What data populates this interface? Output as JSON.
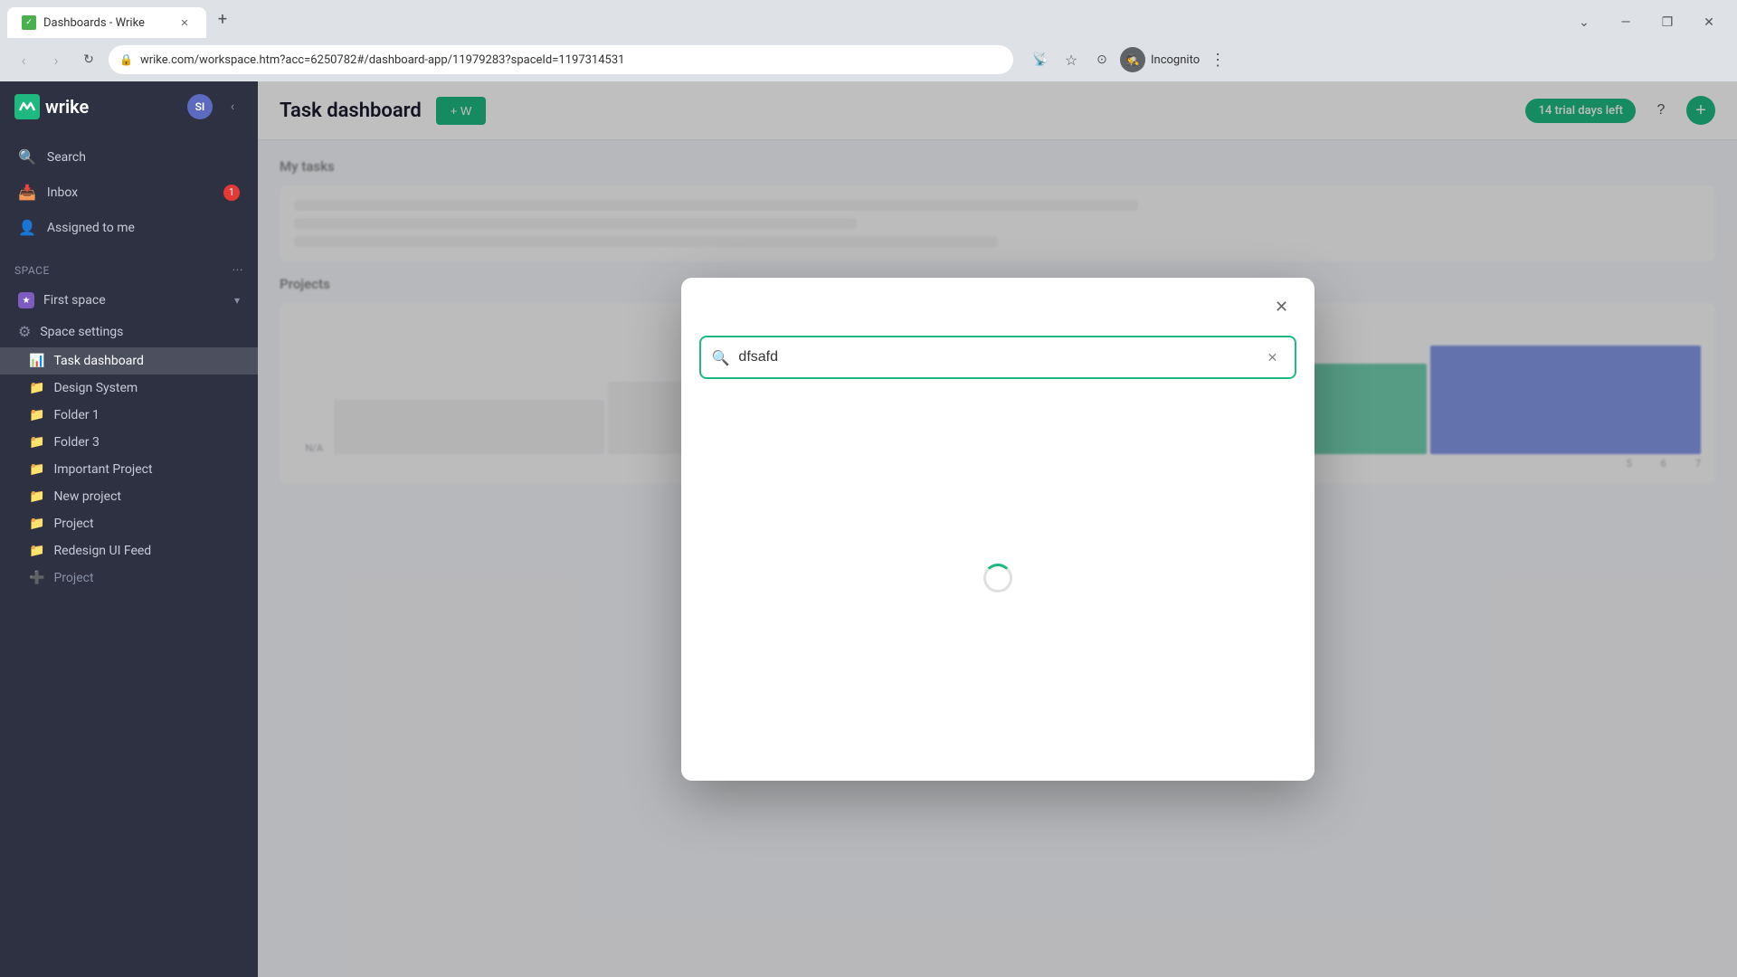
{
  "browser": {
    "tab": {
      "title": "Dashboards - Wrike",
      "favicon_color": "#4caf50"
    },
    "url": "wrike.com/workspace.htm?acc=6250782#/dashboard-app/11979283?spaceId=1197314531",
    "window_controls": {
      "minimize": "—",
      "maximize": "❐",
      "close": "✕",
      "chevron_down": "⌄"
    },
    "incognito_label": "Incognito"
  },
  "sidebar": {
    "logo_text": "wrike",
    "avatar_initials": "SI",
    "nav_items": [
      {
        "id": "search",
        "label": "Search",
        "icon": "🔍"
      },
      {
        "id": "inbox",
        "label": "Inbox",
        "icon": "📥",
        "badge": "1"
      },
      {
        "id": "assigned",
        "label": "Assigned to me",
        "icon": "👤"
      }
    ],
    "space_section_label": "Space",
    "space": {
      "name": "First space",
      "icon": "★"
    },
    "space_settings": {
      "label": "Space settings",
      "icon": "⚙"
    },
    "tree_items": [
      {
        "id": "task-dashboard",
        "label": "Task dashboard",
        "icon": "📊",
        "active": true
      },
      {
        "id": "design-system",
        "label": "Design System",
        "icon": "📁"
      },
      {
        "id": "folder-1",
        "label": "Folder 1",
        "icon": "📁"
      },
      {
        "id": "folder-3",
        "label": "Folder 3",
        "icon": "📁"
      },
      {
        "id": "important-project",
        "label": "Important Project",
        "icon": "📁"
      },
      {
        "id": "new-project",
        "label": "New project",
        "icon": "📁"
      },
      {
        "id": "project",
        "label": "Project",
        "icon": "📁"
      },
      {
        "id": "redesign-ui",
        "label": "Redesign UI Feed",
        "icon": "📁"
      },
      {
        "id": "project2",
        "label": "Project",
        "icon": "➕"
      }
    ]
  },
  "main": {
    "title": "Task dashboard",
    "add_widget_label": "+ W",
    "trial_badge": "14 trial days left",
    "sections": [
      {
        "title": "My tasks"
      },
      {
        "title": "Projects"
      }
    ],
    "na_label": "N/A",
    "chart_x_labels": [
      "5",
      "6",
      "7"
    ]
  },
  "modal": {
    "close_icon": "✕",
    "search": {
      "placeholder": "dfsafd",
      "value": "dfsafd",
      "icon": "🔍",
      "clear_icon": "✕"
    },
    "loading": true
  }
}
